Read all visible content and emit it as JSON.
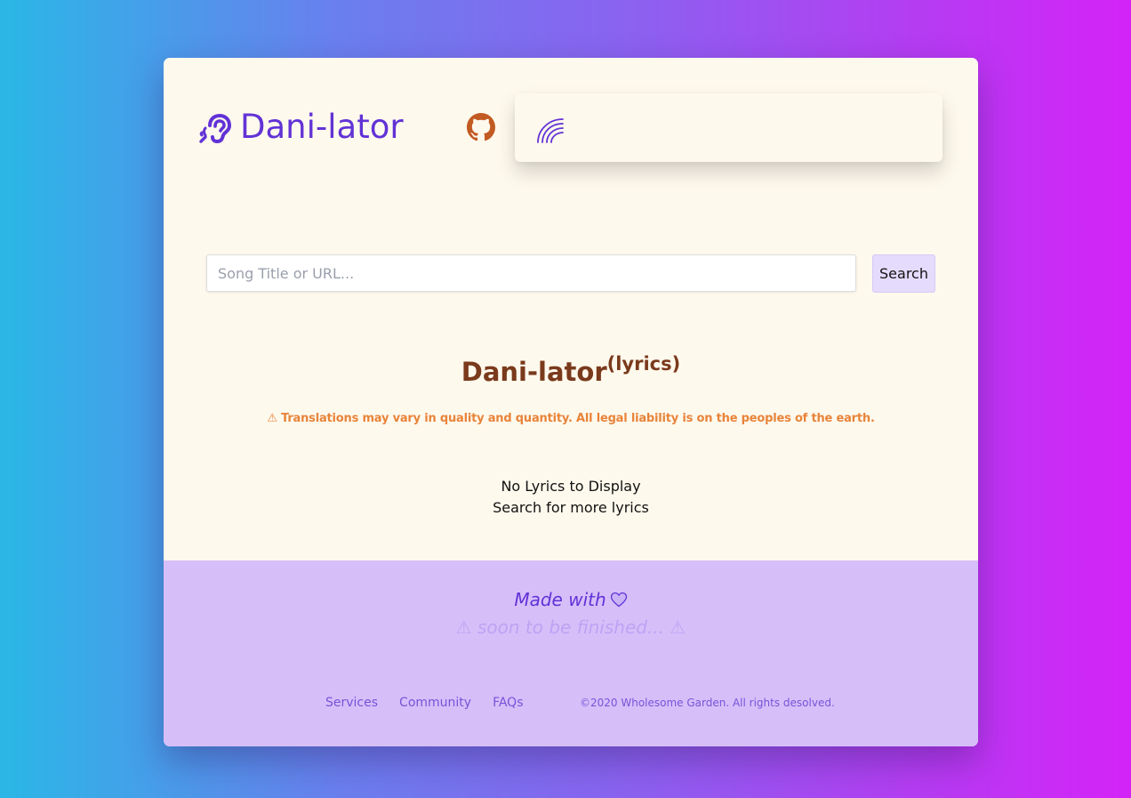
{
  "header": {
    "app_name": "Dani-lator",
    "brand_icon": "ear-listen-icon",
    "github_icon": "github-icon",
    "player_icon": "rainbow-icon"
  },
  "search": {
    "placeholder": "Song Title or URL...",
    "value": "",
    "button_label": "Search"
  },
  "main": {
    "title": "Dani-lator",
    "title_sup": "(lyrics)",
    "warning": "⚠ Translations may vary in quality and quantity. All legal liability is on the peoples of the earth.",
    "empty_line_1": "No Lyrics to Display",
    "empty_line_2": "Search for more lyrics"
  },
  "footer": {
    "made_with": "Made with",
    "heart_icon": "heart-icon",
    "soon": "⚠ soon to be finished... ⚠",
    "links": [
      "Services",
      "Community",
      "FAQs"
    ],
    "copyright": "©2020 Wholesome Garden. All rights desolved."
  },
  "colors": {
    "brand": "#6232d6",
    "github": "#c25a22",
    "title": "#7a3a1c",
    "warning": "#e8843a",
    "card_bg": "#fef9ed",
    "footer_bg": "#d6bff9",
    "button_bg": "#e5dcfd"
  }
}
